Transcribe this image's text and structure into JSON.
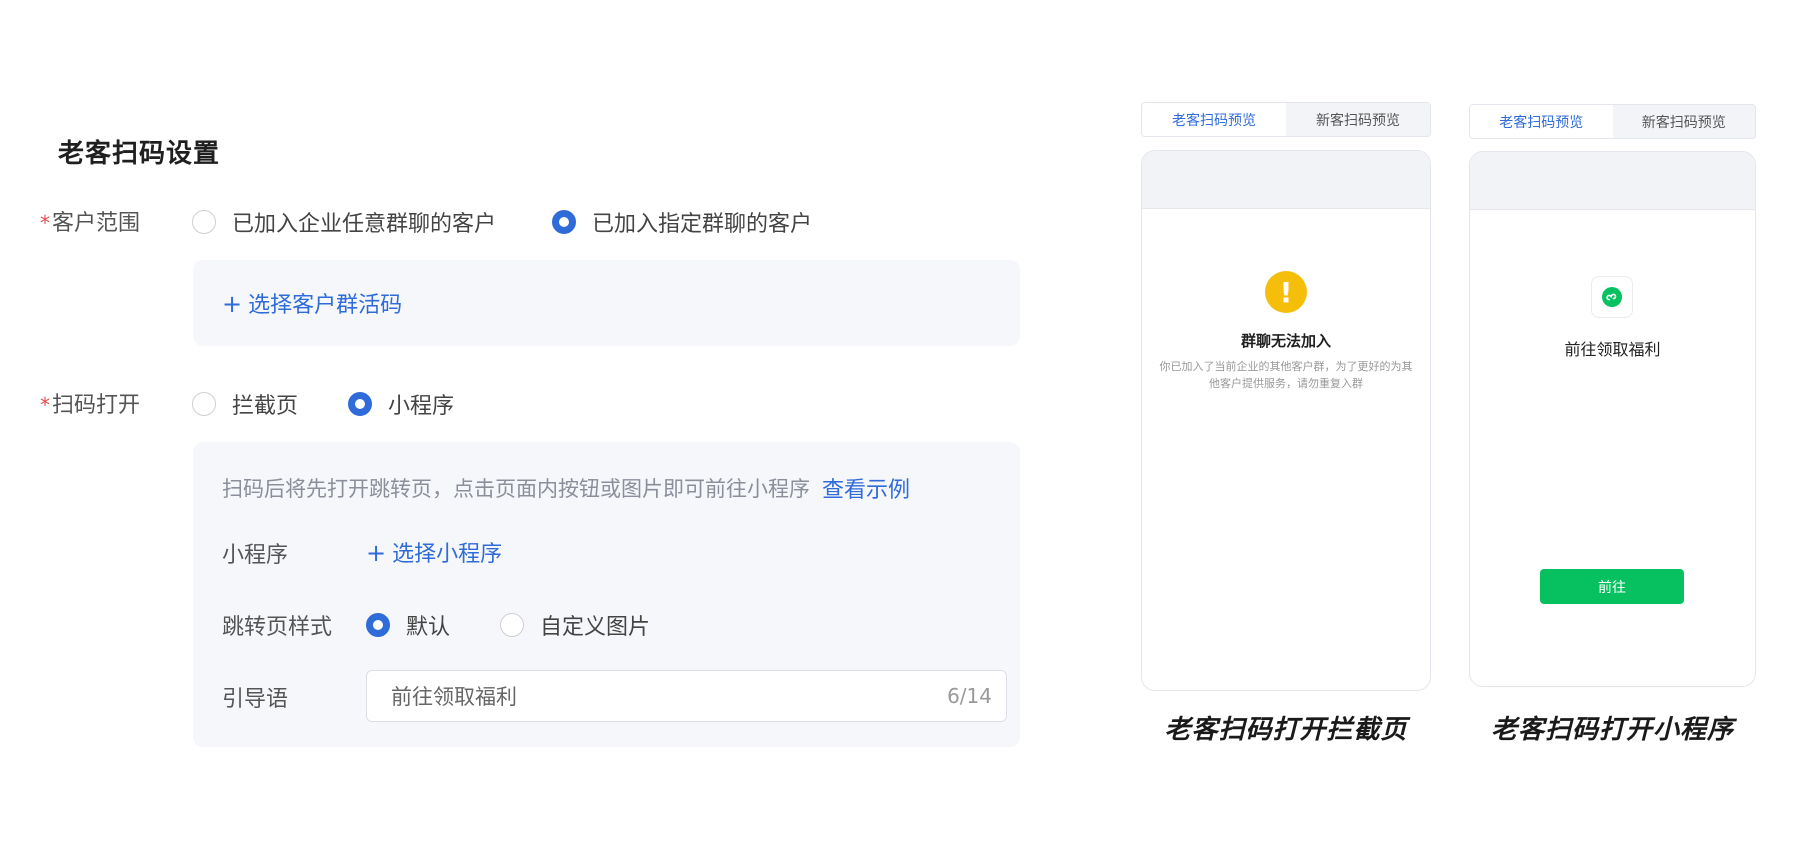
{
  "settings": {
    "title": "老客扫码设置",
    "required_mark": "*",
    "customer_scope": {
      "label": "客户范围",
      "options": [
        "已加入企业任意群聊的客户",
        "已加入指定群聊的客户"
      ],
      "selected": "已加入指定群聊的客户",
      "select_group_code": "选择客户群活码"
    },
    "scan_open": {
      "label": "扫码打开",
      "options": [
        "拦截页",
        "小程序"
      ],
      "selected": "小程序",
      "hint": "扫码后将先打开跳转页，点击页面内按钮或图片即可前往小程序",
      "view_example": "查看示例",
      "mini_program_label": "小程序",
      "select_mini_program": "选择小程序",
      "jump_style_label": "跳转页样式",
      "jump_style_options": [
        "默认",
        "自定义图片"
      ],
      "jump_style_selected": "默认",
      "guide_label": "引导语",
      "guide_value": "前往领取福利",
      "guide_count": "6/14"
    },
    "plus_glyph": "+"
  },
  "preview_left": {
    "tabs": [
      "老客扫码预览",
      "新客扫码预览"
    ],
    "active_tab": "老客扫码预览",
    "warning_glyph": "!",
    "title": "群聊无法加入",
    "desc_line1": "你已加入了当前企业的其他客户群，为了更好的为其",
    "desc_line2": "他客户提供服务，请勿重复入群",
    "caption": "老客扫码打开拦截页",
    "icon": "warning-icon",
    "icon_color": "#f5be0b"
  },
  "preview_right": {
    "tabs": [
      "老客扫码预览",
      "新客扫码预览"
    ],
    "active_tab": "老客扫码预览",
    "title": "前往领取福利",
    "button": "前往",
    "caption": "老客扫码打开小程序",
    "icon": "mini-program-icon",
    "button_color": "#07c160"
  },
  "colors": {
    "accent": "#2f6bd9",
    "required": "#e34d4d",
    "panel_bg": "#f5f7fb"
  }
}
